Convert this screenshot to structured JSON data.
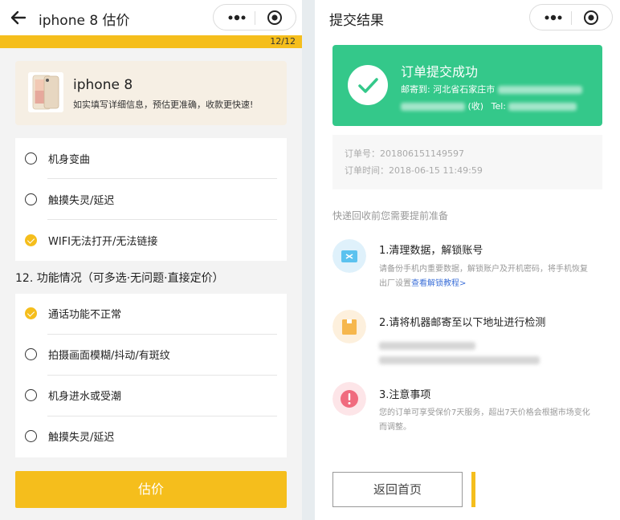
{
  "left": {
    "header": {
      "title": "iphone 8 估价",
      "back_icon": "back-arrow-icon",
      "more_icon": "more-dots-icon",
      "close_icon": "target-circle-icon"
    },
    "progress": {
      "text": "12/12",
      "value": 1.0
    },
    "product": {
      "name": "iphone 8",
      "tip": "如实填写详细信息，预估更准确，收款更快速!"
    },
    "group_a": {
      "options": [
        {
          "label": "机身变曲",
          "checked": false
        },
        {
          "label": "触摸失灵/延迟",
          "checked": false
        },
        {
          "label": "WIFI无法打开/无法链接",
          "checked": true
        }
      ]
    },
    "section_title": "12. 功能情况（可多选·无问题·直接定价）",
    "group_b": {
      "options": [
        {
          "label": "通话功能不正常",
          "checked": true
        },
        {
          "label": "拍摄画面模糊/抖动/有斑纹",
          "checked": false
        },
        {
          "label": "机身进水或受潮",
          "checked": false
        },
        {
          "label": "触摸失灵/延迟",
          "checked": false
        }
      ]
    },
    "estimate_button": "估价"
  },
  "right": {
    "header": {
      "title": "提交结果"
    },
    "success": {
      "title": "订单提交成功",
      "ship_prefix": "邮寄到: 河北省石家庄市",
      "recv": "(收)",
      "tel": "Tel:"
    },
    "order": {
      "number": "订单号：201806151149597",
      "time": "订单时间：2018-06-15 11:49:59"
    },
    "prep_title": "快递回收前您需要提前准备",
    "steps": [
      {
        "title": "1.清理数据，解锁账号",
        "desc1": "请备份手机内重要数据，解锁账户及开机密码，将手机恢复",
        "desc2": "出厂设置",
        "link": "查看解锁教程>",
        "icon": "folder-icon"
      },
      {
        "title": "2.请将机器邮寄至以下地址进行检测",
        "icon": "package-box-icon"
      },
      {
        "title": "3.注意事项",
        "desc1": "您的订单可享受保价7天服务，超出7天价格会根据市场变化",
        "desc2": "而调整。",
        "icon": "exclamation-icon"
      }
    ],
    "home_button": "返回首页"
  },
  "colors": {
    "accent": "#f5be1c",
    "success": "#34c88a",
    "link": "#3b6fd8"
  }
}
